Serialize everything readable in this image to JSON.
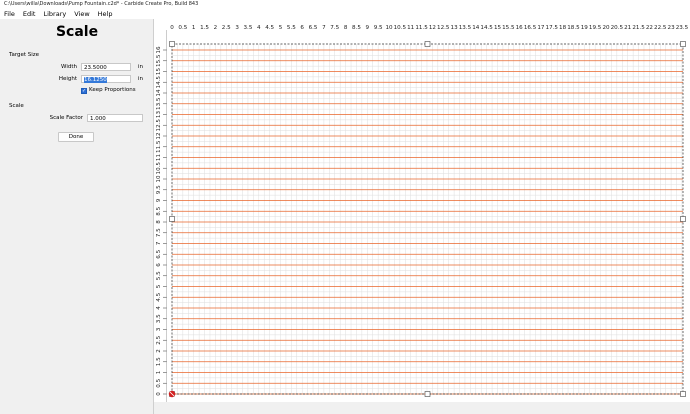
{
  "window": {
    "title": "C:\\Users\\willa\\Downloads\\Pump Fountain.c2d* - Carbide Create Pro, Build 843"
  },
  "menu": [
    "File",
    "Edit",
    "Library",
    "View",
    "Help"
  ],
  "panel": {
    "title": "Scale",
    "target_section": "Target Size",
    "width_label": "Width",
    "width_value": "23.5000",
    "width_unit": "in",
    "height_label": "Height",
    "height_value": "16.1250",
    "height_unit": "in",
    "keep_proportions_label": "Keep Proportions",
    "keep_proportions_checked": true,
    "scale_section": "Scale",
    "scale_factor_label": "Scale Factor",
    "scale_factor_value": "1.000",
    "done_label": "Done"
  },
  "rulers": {
    "horizontal": [
      "0",
      "0.5",
      "1",
      "1.5",
      "2",
      "2.5",
      "3",
      "3.5",
      "4",
      "4.5",
      "5",
      "5.5",
      "6",
      "6.5",
      "7",
      "7.5",
      "8",
      "8.5",
      "9",
      "9.5",
      "10",
      "10.5",
      "11",
      "11.5",
      "12",
      "12.5",
      "13",
      "13.5",
      "14",
      "14.5",
      "15",
      "15.5",
      "16",
      "16.5",
      "17",
      "17.5",
      "18",
      "18.5",
      "19",
      "19.5",
      "20",
      "20.5",
      "21",
      "21.5",
      "22",
      "22.5",
      "23",
      "23.5"
    ],
    "vertical": [
      "0",
      "0.5",
      "1",
      "1.5",
      "2",
      "2.5",
      "3",
      "3.5",
      "4",
      "4.5",
      "5",
      "5.5",
      "6",
      "6.5",
      "7",
      "7.5",
      "8",
      "8.5",
      "9",
      "9.5",
      "10",
      "10.5",
      "11",
      "11.5",
      "12",
      "12.5",
      "13",
      "13.5",
      "14",
      "14.5",
      "15",
      "15.5",
      "16"
    ]
  },
  "colors": {
    "grid_major": "#e8642a",
    "grid_minor": "#dddddd",
    "selection": "#3479d9",
    "origin": "#d42020"
  }
}
